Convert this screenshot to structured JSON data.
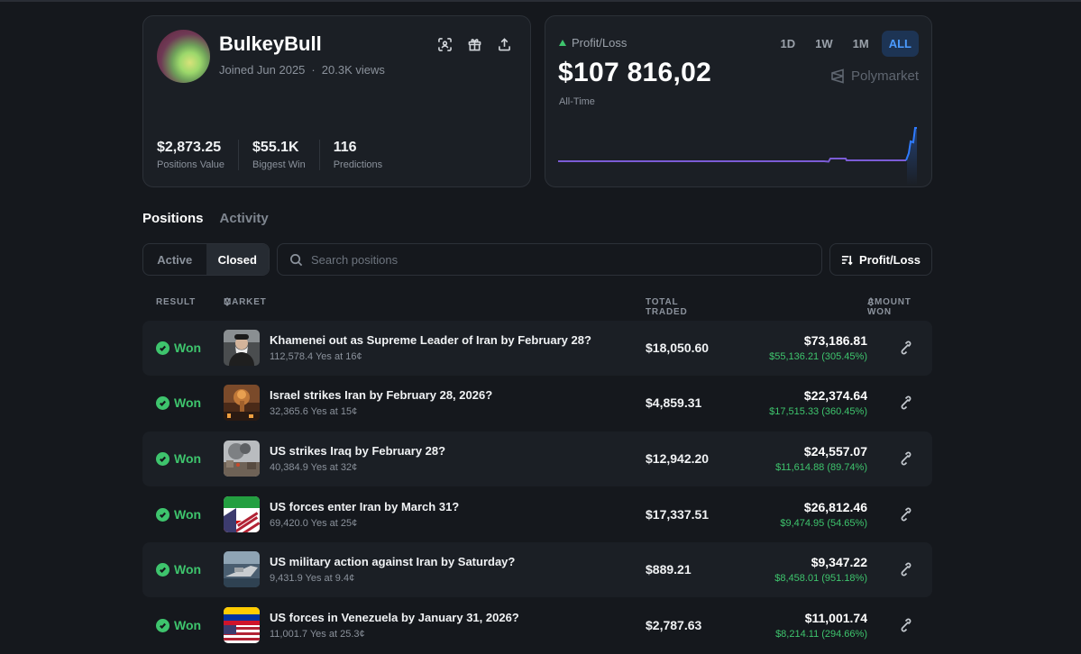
{
  "profile": {
    "username": "BulkeyBull",
    "joined": "Joined Jun 2025",
    "views": "20.3K views",
    "icons": [
      "scan-icon",
      "gift-icon",
      "share-upload-icon"
    ],
    "stats": [
      {
        "value": "$2,873.25",
        "label": "Positions Value"
      },
      {
        "value": "$55.1K",
        "label": "Biggest Win"
      },
      {
        "value": "116",
        "label": "Predictions"
      }
    ]
  },
  "pnl": {
    "label": "Profit/Loss",
    "value": "$107 816,02",
    "period": "All-Time",
    "ranges": [
      "1D",
      "1W",
      "1M",
      "ALL"
    ],
    "selected_range": "ALL",
    "brand": "Polymarket",
    "colors": {
      "line": "#7b5cd6",
      "spike": "#2f7bff",
      "up": "#3ec46d"
    }
  },
  "tabs": {
    "positions": "Positions",
    "activity": "Activity",
    "selected": "Positions"
  },
  "filters": {
    "active": "Active",
    "closed": "Closed",
    "selected": "Closed",
    "search_placeholder": "Search positions",
    "sort_label": "Profit/Loss"
  },
  "table": {
    "headers": {
      "result": "RESULT",
      "market": "MARKET",
      "total_traded": "TOTAL TRADED",
      "amount_won": "AMOUNT WON"
    },
    "rows": [
      {
        "result": "Won",
        "title": "Khamenei out as Supreme Leader of Iran by February 28?",
        "sub": "112,578.4 Yes at 16¢",
        "traded": "$18,050.60",
        "won": "$73,186.81",
        "profit": "$55,136.21 (305.45%)"
      },
      {
        "result": "Won",
        "title": "Israel strikes Iran by February 28, 2026?",
        "sub": "32,365.6 Yes at 15¢",
        "traded": "$4,859.31",
        "won": "$22,374.64",
        "profit": "$17,515.33 (360.45%)"
      },
      {
        "result": "Won",
        "title": "US strikes Iraq by February 28?",
        "sub": "40,384.9 Yes at 32¢",
        "traded": "$12,942.20",
        "won": "$24,557.07",
        "profit": "$11,614.88 (89.74%)"
      },
      {
        "result": "Won",
        "title": "US forces enter Iran by March 31?",
        "sub": "69,420.0 Yes at 25¢",
        "traded": "$17,337.51",
        "won": "$26,812.46",
        "profit": "$9,474.95 (54.65%)"
      },
      {
        "result": "Won",
        "title": "US military action against Iran by Saturday?",
        "sub": "9,431.9 Yes at 9.4¢",
        "traded": "$889.21",
        "won": "$9,347.22",
        "profit": "$8,458.01 (951.18%)"
      },
      {
        "result": "Won",
        "title": "US forces in Venezuela by January 31, 2026?",
        "sub": "11,001.7 Yes at 25.3¢",
        "traded": "$2,787.63",
        "won": "$11,001.74",
        "profit": "$8,214.11 (294.66%)"
      }
    ]
  }
}
